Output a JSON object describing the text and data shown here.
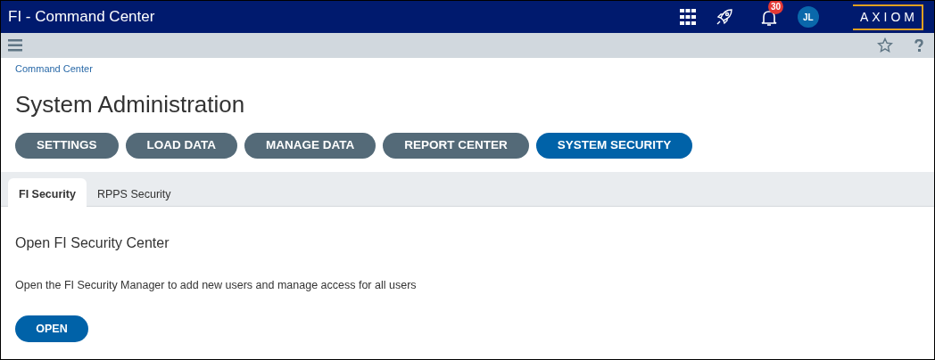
{
  "window": {
    "title": "FI - Command Center"
  },
  "header": {
    "notification_count": "30",
    "avatar": "JL",
    "logo": "AXIOM"
  },
  "breadcrumb": "Command Center",
  "page_title": "System Administration",
  "nav_buttons": [
    {
      "label": "SETTINGS",
      "selected": false
    },
    {
      "label": "LOAD DATA",
      "selected": false
    },
    {
      "label": "MANAGE DATA",
      "selected": false
    },
    {
      "label": "REPORT CENTER",
      "selected": false
    },
    {
      "label": "SYSTEM SECURITY",
      "selected": true
    }
  ],
  "tabs": [
    {
      "label": "FI Security",
      "selected": true
    },
    {
      "label": "RPPS Security",
      "selected": false
    }
  ],
  "section": {
    "heading": "Open FI Security Center",
    "description": "Open the FI Security Manager to add new users and manage access for all users",
    "button": "OPEN"
  }
}
